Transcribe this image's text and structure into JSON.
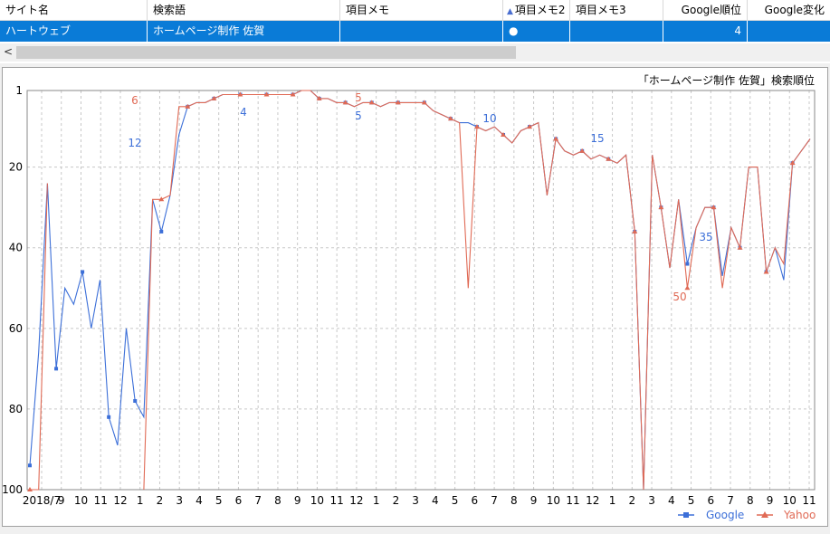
{
  "table": {
    "columns": [
      {
        "label": "サイト名",
        "sort": false
      },
      {
        "label": "検索語",
        "sort": false
      },
      {
        "label": "項目メモ",
        "sort": false
      },
      {
        "label": "項目メモ2",
        "sort": true
      },
      {
        "label": "項目メモ3",
        "sort": false
      },
      {
        "label": "Google順位",
        "sort": false
      },
      {
        "label": "Google変化",
        "sort": false
      }
    ],
    "row": {
      "site": "ハートウェブ",
      "keyword": "ホームページ制作 佐賀",
      "memo": "",
      "memo2": "●",
      "memo3": "",
      "google_rank": "4",
      "google_change": ""
    }
  },
  "scrollbar": {
    "left_arrow": "<"
  },
  "chart_data": {
    "type": "line",
    "title": "「ホームページ制作 佐賀」検索順位",
    "y_reversed": true,
    "ylim": [
      100,
      1
    ],
    "y_ticks": [
      "1",
      "20",
      "40",
      "60",
      "80",
      "100"
    ],
    "x_tick_labels": [
      "2018/7",
      "9",
      "10",
      "11",
      "12",
      "1",
      "2",
      "3",
      "4",
      "5",
      "6",
      "7",
      "8",
      "9",
      "10",
      "11",
      "12",
      "1",
      "2",
      "3",
      "4",
      "5",
      "6",
      "7",
      "8",
      "9",
      "10",
      "11",
      "12",
      "1",
      "2",
      "3",
      "4",
      "5",
      "6",
      "7",
      "8",
      "9",
      "10",
      "11"
    ],
    "grid": true,
    "legend_position": "bottom-right",
    "series": [
      {
        "name": "Google",
        "color": "#3c6fd8",
        "values": [
          94,
          66,
          24,
          70,
          50,
          54,
          46,
          60,
          48,
          82,
          89,
          60,
          78,
          82,
          28,
          36,
          27,
          12,
          5,
          4,
          4,
          3,
          2,
          2,
          2,
          2,
          2,
          2,
          2,
          2,
          2,
          1,
          1,
          3,
          3,
          4,
          4,
          5,
          4,
          4,
          5,
          4,
          4,
          4,
          4,
          4,
          6,
          7,
          8,
          9,
          9,
          10,
          11,
          10,
          12,
          14,
          11,
          10,
          9,
          27,
          13,
          16,
          17,
          16,
          18,
          17,
          18,
          19,
          17,
          36,
          100,
          17,
          30,
          45,
          28,
          44,
          35,
          30,
          30,
          47,
          35,
          40,
          20,
          20,
          46,
          40,
          48,
          19,
          16,
          13
        ]
      },
      {
        "name": "Yahoo",
        "color": "#e06a55",
        "values": [
          100,
          100,
          24,
          null,
          null,
          null,
          null,
          null,
          null,
          null,
          null,
          null,
          null,
          100,
          28,
          28,
          27,
          5,
          5,
          4,
          4,
          3,
          2,
          2,
          2,
          2,
          2,
          2,
          2,
          2,
          2,
          1,
          1,
          3,
          3,
          4,
          4,
          5,
          4,
          4,
          5,
          4,
          4,
          4,
          4,
          4,
          6,
          7,
          8,
          9,
          50,
          10,
          11,
          10,
          12,
          14,
          11,
          10,
          9,
          27,
          13,
          16,
          17,
          16,
          18,
          17,
          18,
          19,
          17,
          36,
          100,
          17,
          30,
          45,
          28,
          50,
          35,
          30,
          30,
          50,
          35,
          40,
          20,
          20,
          46,
          40,
          44,
          19,
          16,
          13
        ]
      }
    ],
    "annotations": [
      {
        "text": "6",
        "series": "Yahoo"
      },
      {
        "text": "12",
        "series": "Google"
      },
      {
        "text": "4",
        "series": "Google"
      },
      {
        "text": "5",
        "series": "Yahoo"
      },
      {
        "text": "5",
        "series": "Google"
      },
      {
        "text": "10",
        "series": "Google"
      },
      {
        "text": "15",
        "series": "Google"
      },
      {
        "text": "35",
        "series": "Google"
      },
      {
        "text": "50",
        "series": "Yahoo"
      }
    ]
  }
}
